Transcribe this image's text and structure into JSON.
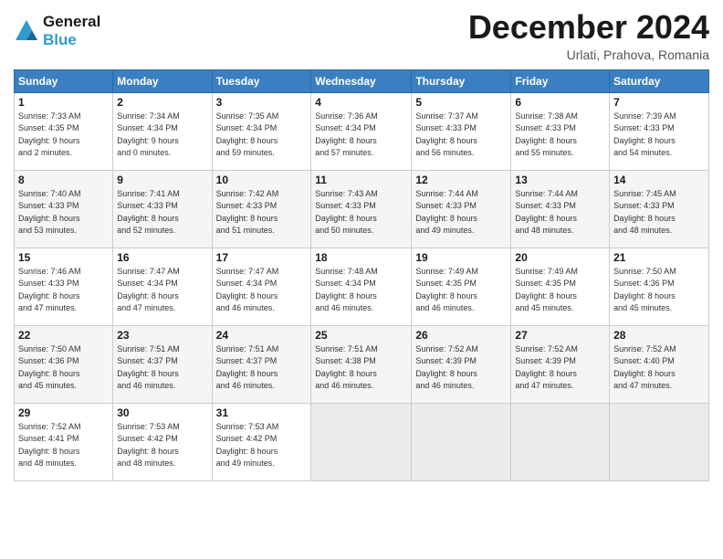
{
  "header": {
    "logo_line1": "General",
    "logo_line2": "Blue",
    "month": "December 2024",
    "location": "Urlati, Prahova, Romania"
  },
  "weekdays": [
    "Sunday",
    "Monday",
    "Tuesday",
    "Wednesday",
    "Thursday",
    "Friday",
    "Saturday"
  ],
  "weeks": [
    [
      {
        "day": "1",
        "info": "Sunrise: 7:33 AM\nSunset: 4:35 PM\nDaylight: 9 hours\nand 2 minutes."
      },
      {
        "day": "2",
        "info": "Sunrise: 7:34 AM\nSunset: 4:34 PM\nDaylight: 9 hours\nand 0 minutes."
      },
      {
        "day": "3",
        "info": "Sunrise: 7:35 AM\nSunset: 4:34 PM\nDaylight: 8 hours\nand 59 minutes."
      },
      {
        "day": "4",
        "info": "Sunrise: 7:36 AM\nSunset: 4:34 PM\nDaylight: 8 hours\nand 57 minutes."
      },
      {
        "day": "5",
        "info": "Sunrise: 7:37 AM\nSunset: 4:33 PM\nDaylight: 8 hours\nand 56 minutes."
      },
      {
        "day": "6",
        "info": "Sunrise: 7:38 AM\nSunset: 4:33 PM\nDaylight: 8 hours\nand 55 minutes."
      },
      {
        "day": "7",
        "info": "Sunrise: 7:39 AM\nSunset: 4:33 PM\nDaylight: 8 hours\nand 54 minutes."
      }
    ],
    [
      {
        "day": "8",
        "info": "Sunrise: 7:40 AM\nSunset: 4:33 PM\nDaylight: 8 hours\nand 53 minutes."
      },
      {
        "day": "9",
        "info": "Sunrise: 7:41 AM\nSunset: 4:33 PM\nDaylight: 8 hours\nand 52 minutes."
      },
      {
        "day": "10",
        "info": "Sunrise: 7:42 AM\nSunset: 4:33 PM\nDaylight: 8 hours\nand 51 minutes."
      },
      {
        "day": "11",
        "info": "Sunrise: 7:43 AM\nSunset: 4:33 PM\nDaylight: 8 hours\nand 50 minutes."
      },
      {
        "day": "12",
        "info": "Sunrise: 7:44 AM\nSunset: 4:33 PM\nDaylight: 8 hours\nand 49 minutes."
      },
      {
        "day": "13",
        "info": "Sunrise: 7:44 AM\nSunset: 4:33 PM\nDaylight: 8 hours\nand 48 minutes."
      },
      {
        "day": "14",
        "info": "Sunrise: 7:45 AM\nSunset: 4:33 PM\nDaylight: 8 hours\nand 48 minutes."
      }
    ],
    [
      {
        "day": "15",
        "info": "Sunrise: 7:46 AM\nSunset: 4:33 PM\nDaylight: 8 hours\nand 47 minutes."
      },
      {
        "day": "16",
        "info": "Sunrise: 7:47 AM\nSunset: 4:34 PM\nDaylight: 8 hours\nand 47 minutes."
      },
      {
        "day": "17",
        "info": "Sunrise: 7:47 AM\nSunset: 4:34 PM\nDaylight: 8 hours\nand 46 minutes."
      },
      {
        "day": "18",
        "info": "Sunrise: 7:48 AM\nSunset: 4:34 PM\nDaylight: 8 hours\nand 46 minutes."
      },
      {
        "day": "19",
        "info": "Sunrise: 7:49 AM\nSunset: 4:35 PM\nDaylight: 8 hours\nand 46 minutes."
      },
      {
        "day": "20",
        "info": "Sunrise: 7:49 AM\nSunset: 4:35 PM\nDaylight: 8 hours\nand 45 minutes."
      },
      {
        "day": "21",
        "info": "Sunrise: 7:50 AM\nSunset: 4:36 PM\nDaylight: 8 hours\nand 45 minutes."
      }
    ],
    [
      {
        "day": "22",
        "info": "Sunrise: 7:50 AM\nSunset: 4:36 PM\nDaylight: 8 hours\nand 45 minutes."
      },
      {
        "day": "23",
        "info": "Sunrise: 7:51 AM\nSunset: 4:37 PM\nDaylight: 8 hours\nand 46 minutes."
      },
      {
        "day": "24",
        "info": "Sunrise: 7:51 AM\nSunset: 4:37 PM\nDaylight: 8 hours\nand 46 minutes."
      },
      {
        "day": "25",
        "info": "Sunrise: 7:51 AM\nSunset: 4:38 PM\nDaylight: 8 hours\nand 46 minutes."
      },
      {
        "day": "26",
        "info": "Sunrise: 7:52 AM\nSunset: 4:39 PM\nDaylight: 8 hours\nand 46 minutes."
      },
      {
        "day": "27",
        "info": "Sunrise: 7:52 AM\nSunset: 4:39 PM\nDaylight: 8 hours\nand 47 minutes."
      },
      {
        "day": "28",
        "info": "Sunrise: 7:52 AM\nSunset: 4:40 PM\nDaylight: 8 hours\nand 47 minutes."
      }
    ],
    [
      {
        "day": "29",
        "info": "Sunrise: 7:52 AM\nSunset: 4:41 PM\nDaylight: 8 hours\nand 48 minutes."
      },
      {
        "day": "30",
        "info": "Sunrise: 7:53 AM\nSunset: 4:42 PM\nDaylight: 8 hours\nand 48 minutes."
      },
      {
        "day": "31",
        "info": "Sunrise: 7:53 AM\nSunset: 4:42 PM\nDaylight: 8 hours\nand 49 minutes."
      },
      null,
      null,
      null,
      null
    ]
  ]
}
